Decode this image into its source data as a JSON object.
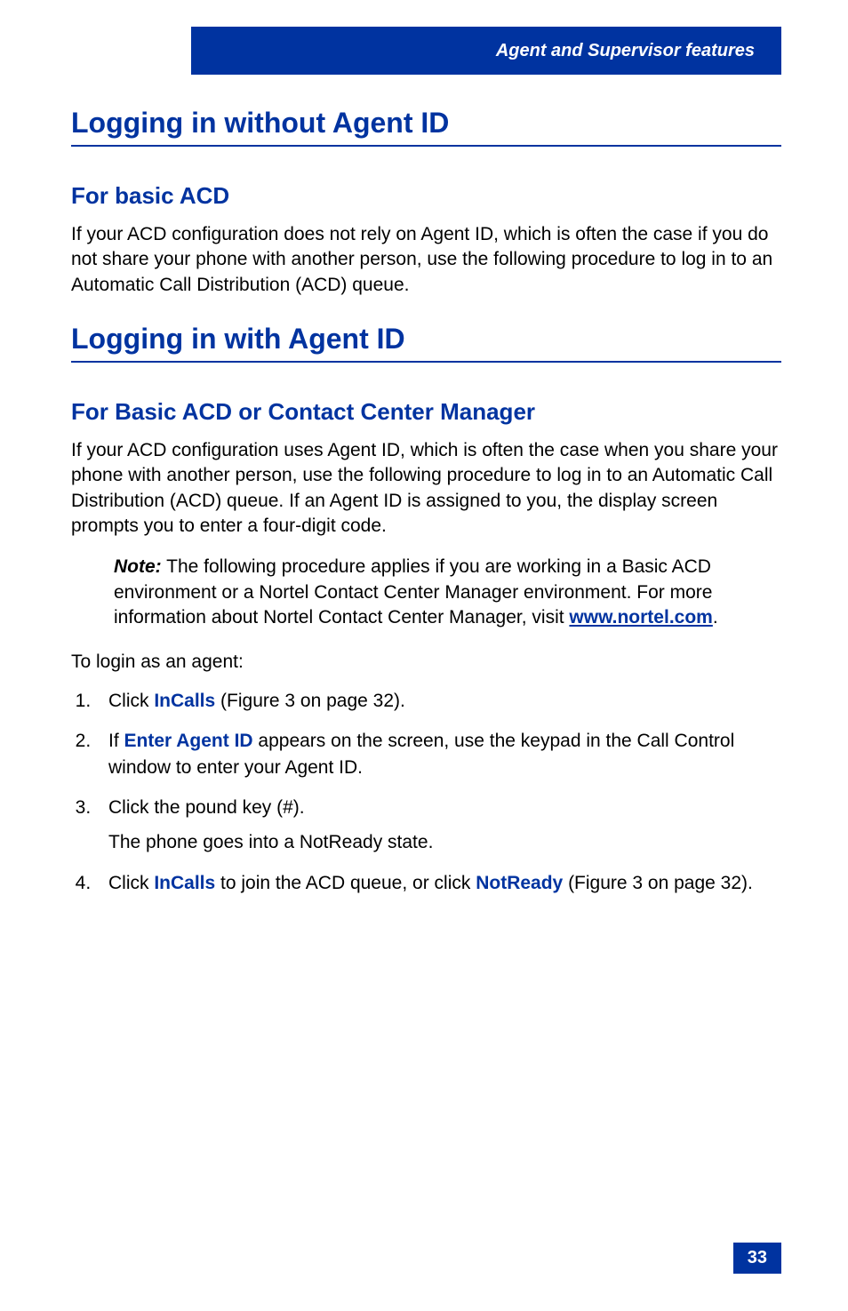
{
  "header": {
    "running_title": "Agent and Supervisor features"
  },
  "sections": [
    {
      "title": "Logging in without Agent ID",
      "sub_title": "For basic ACD",
      "body": "If your ACD configuration does not rely on Agent ID, which is often the case if you do not share your phone with another person, use the following procedure to log in to an Automatic Call Distribution (ACD) queue."
    },
    {
      "title": "Logging in with Agent ID",
      "sub_title": "For Basic ACD or Contact Center Manager",
      "body": "If your ACD configuration uses Agent ID, which is often the case when you share your phone with another person, use the following procedure to log in to an Automatic Call Distribution (ACD) queue. If an Agent ID is assigned to you, the display screen prompts you to enter a four-digit code."
    }
  ],
  "note": {
    "label": "Note:",
    "text": " The following procedure applies if you are working in a Basic ACD environment or a Nortel Contact Center Manager environment. For more information about Nortel Contact Center Manager, visit ",
    "link": "www.nortel.com",
    "after": "."
  },
  "login_intro": "To login as an agent:",
  "steps": {
    "s1_pre": "Click ",
    "s1_bold": "InCalls",
    "s1_post": " (Figure 3 on page 32).",
    "s2_pre": "If ",
    "s2_bold": "Enter Agent ID",
    "s2_post": " appears on the screen, use the keypad in the Call Control window to enter your Agent ID.",
    "s3_text": "Click the pound key (#).",
    "s3_sub": "The phone goes into a NotReady state.",
    "s4_pre": "Click ",
    "s4_bold1": "InCalls",
    "s4_mid": " to join the ACD queue, or click ",
    "s4_bold2": "NotReady",
    "s4_post": " (Figure 3 on page 32)."
  },
  "page_number": "33"
}
